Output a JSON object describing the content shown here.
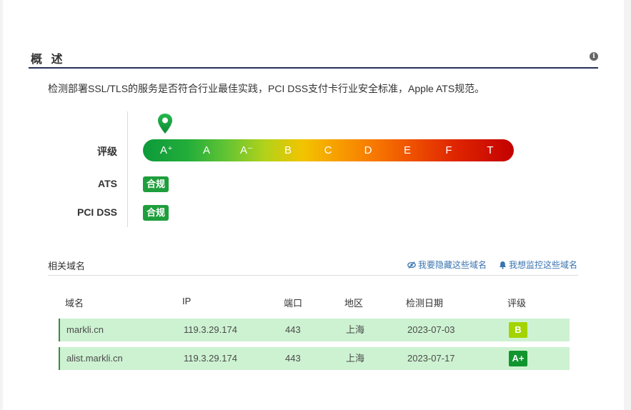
{
  "section": {
    "title": "概 述"
  },
  "description": "检测部署SSL/TLS的服务是否符合行业最佳实践，PCI DSS支付卡行业安全标准，Apple ATS规范。",
  "rating": {
    "label": "评级",
    "grades": [
      "A⁺",
      "A",
      "A⁻",
      "B",
      "C",
      "D",
      "E",
      "F",
      "T"
    ],
    "current": "A+"
  },
  "ats": {
    "label": "ATS",
    "status": "合规"
  },
  "pci": {
    "label": "PCI DSS",
    "status": "合规"
  },
  "related": {
    "title": "相关域名",
    "hide_link": "我要隐藏这些域名",
    "monitor_link": "我想监控这些域名"
  },
  "table": {
    "headers": [
      "域名",
      "IP",
      "端口",
      "地区",
      "检测日期",
      "评级"
    ],
    "rows": [
      {
        "domain": "markli.cn",
        "ip": "119.3.29.174",
        "port": "443",
        "region": "上海",
        "date": "2023-07-03",
        "grade": "B",
        "grade_color": "#a3d400"
      },
      {
        "domain": "alist.markli.cn",
        "ip": "119.3.29.174",
        "port": "443",
        "region": "上海",
        "date": "2023-07-17",
        "grade": "A+",
        "grade_color": "#11952f"
      }
    ]
  },
  "colors": {
    "accent_line": "#26325a",
    "pass_green": "#1e9e3c",
    "row_bg": "#cdf2d1",
    "link": "#3a74b0"
  }
}
